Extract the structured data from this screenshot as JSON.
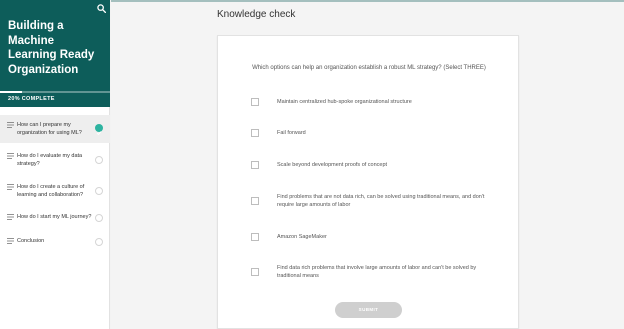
{
  "sidebar": {
    "course_title": "Building a Machine Learning Ready Organization",
    "progress_label": "20% COMPLETE",
    "progress_percent": 20,
    "lessons": [
      {
        "label": "How can I prepare my organization for using ML?",
        "status": "complete",
        "active": true
      },
      {
        "label": "How do I evaluate my data strategy?",
        "status": "incomplete",
        "active": false
      },
      {
        "label": "How do I create a culture of learning and collaboration?",
        "status": "incomplete",
        "active": false
      },
      {
        "label": "How do I start my ML journey?",
        "status": "incomplete",
        "active": false
      },
      {
        "label": "Conclusion",
        "status": "incomplete",
        "active": false
      }
    ]
  },
  "main": {
    "page_title": "Knowledge check",
    "question": "Which options can help an organization establish a robust ML strategy? (Select THREE)",
    "options": [
      {
        "label": "Maintain centralized hub-spoke organizational structure",
        "checked": false
      },
      {
        "label": "Fail forward",
        "checked": false
      },
      {
        "label": "Scale beyond development proofs of concept",
        "checked": false
      },
      {
        "label": "Find problems that are not data rich, can be solved using traditional means, and don't require large amounts of labor",
        "checked": false
      },
      {
        "label": "Amazon SageMaker",
        "checked": false
      },
      {
        "label": "Find data rich problems that involve large amounts of labor and can't be solved by traditional means",
        "checked": false
      }
    ],
    "submit_label": "SUBMIT"
  },
  "colors": {
    "sidebar_header": "#0d5d5a",
    "complete": "#2db3a0",
    "submit_disabled": "#cfcfcf"
  }
}
